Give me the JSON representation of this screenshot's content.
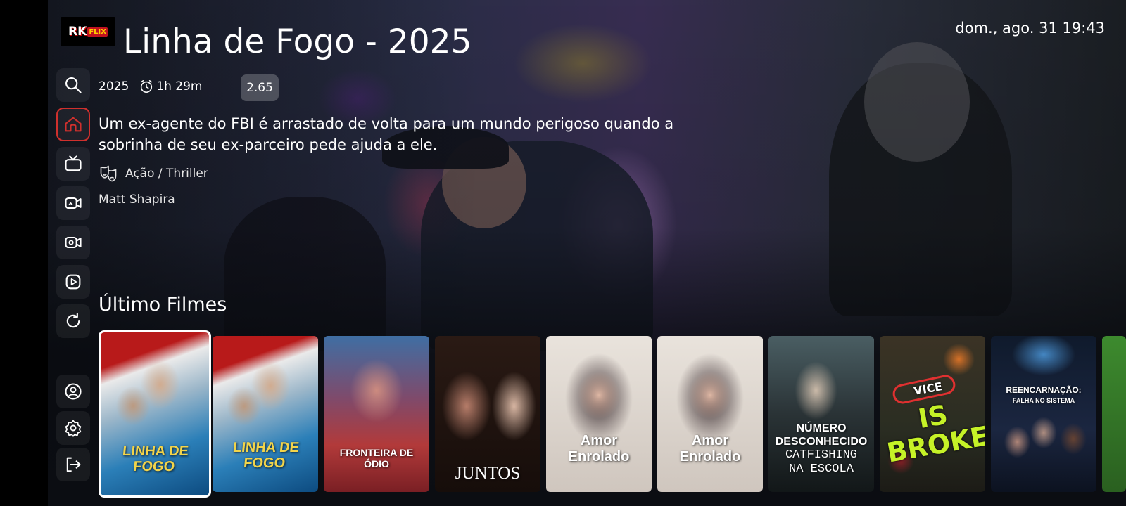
{
  "app": {
    "logo_text": "RK",
    "logo_badge": "FLIX"
  },
  "header": {
    "title": "Linha de Fogo - 2025",
    "datetime": "dom., ago. 31 19:43"
  },
  "sidebar": {
    "items": [
      {
        "name": "search",
        "icon": "search-icon",
        "active": false
      },
      {
        "name": "home",
        "icon": "home-icon",
        "active": true
      },
      {
        "name": "live-tv",
        "icon": "tv-icon",
        "active": false
      },
      {
        "name": "movies",
        "icon": "video-camera-icon",
        "active": false
      },
      {
        "name": "series",
        "icon": "video-icon",
        "active": false
      },
      {
        "name": "play",
        "icon": "play-icon",
        "active": false
      },
      {
        "name": "refresh",
        "icon": "refresh-icon",
        "active": false
      },
      {
        "name": "profile",
        "icon": "user-icon",
        "active": false
      },
      {
        "name": "settings",
        "icon": "gear-icon",
        "active": false
      },
      {
        "name": "logout",
        "icon": "logout-icon",
        "active": false
      }
    ],
    "active_color": "#d0302d"
  },
  "details": {
    "year": "2025",
    "duration": "1h 29m",
    "rating": "2.65",
    "description": "Um ex-agente do FBI é arrastado de volta para um mundo perigoso quando a sobrinha de seu ex-parceiro pede ajuda a ele.",
    "genres": "Ação / Thriller",
    "director": "Matt Shapira"
  },
  "section": {
    "title": "Último Filmes",
    "movies": [
      {
        "title_line1": "LINHA DE",
        "title_line2": "FOGO",
        "selected": true
      },
      {
        "title_line1": "LINHA DE",
        "title_line2": "FOGO",
        "selected": false
      },
      {
        "title_line1": "FRONTEIRA DE ÓDIO",
        "selected": false
      },
      {
        "title_line1": "JUNTOS",
        "selected": false
      },
      {
        "title_line1": "Amor",
        "title_line2": "Enrolado",
        "selected": false
      },
      {
        "title_line1": "Amor",
        "title_line2": "Enrolado",
        "selected": false
      },
      {
        "title_line1": "NÚMERO",
        "title_line2": "DESCONHECIDO",
        "title_line3": "CATFISHING",
        "title_line4": "NA ESCOLA",
        "selected": false
      },
      {
        "title_line1": "VICE",
        "title_line2": "IS",
        "title_line3": "BROKE",
        "selected": false
      },
      {
        "title_line1": "REENCARNAÇÃO:",
        "title_line2": "FALHA NO SISTEMA",
        "selected": false
      }
    ]
  }
}
